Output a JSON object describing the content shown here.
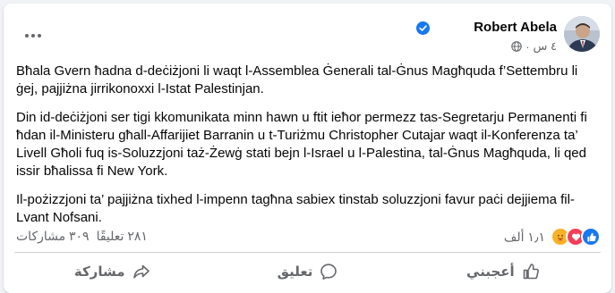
{
  "post": {
    "author": "Robert Abela",
    "time": "٤ س",
    "separator": "·",
    "paragraphs": [
      "Bħala Gvern ħadna d-deċiżjoni li waqt l-Assemblea Ġenerali tal-Ġnus Magħquda f’Settembru li ġej, pajjiżna jirrikonoxxi l-Istat Palestinjan.",
      "Din id-deċiżjoni ser tigi kkomunikata minn hawn u ftit ieħor permezz tas-Segretarju Permanenti fi ħdan il-Ministeru għall-Affarijiet Barranin u t-Turiżmu Christopher Cutajar waqt il-Konferenza ta’ Livell Għoli fuq is-Soluzzjoni taż-Żewġ stati bejn l-Israel u l-Palestina, tal-Ġnus Magħquda, li qed issir bħalissa fi New York.",
      "Il-pożizzjoni ta’ pajjiżna tixhed l-impenn tagħna sabiex tinstab soluzzjoni favur paċi dejjiema fil-Lvant Nofsani."
    ]
  },
  "stats": {
    "reactions_count": "١٫١ ألف",
    "comments": "٢٨١ تعليقًا",
    "shares": "٣٠٩ مشاركات"
  },
  "actions": {
    "like": "أعجبني",
    "comment": "تعليق",
    "share": "مشاركة"
  },
  "colors": {
    "accent": "#1877f2",
    "love": "#f33e58",
    "care": "#f7b125",
    "secondary_text": "#65676b"
  },
  "icons": [
    "more-horizontal-icon",
    "verified-badge-icon",
    "globe-icon",
    "like-reaction-icon",
    "love-reaction-icon",
    "care-reaction-icon",
    "thumbs-up-icon",
    "comment-icon",
    "share-icon"
  ]
}
